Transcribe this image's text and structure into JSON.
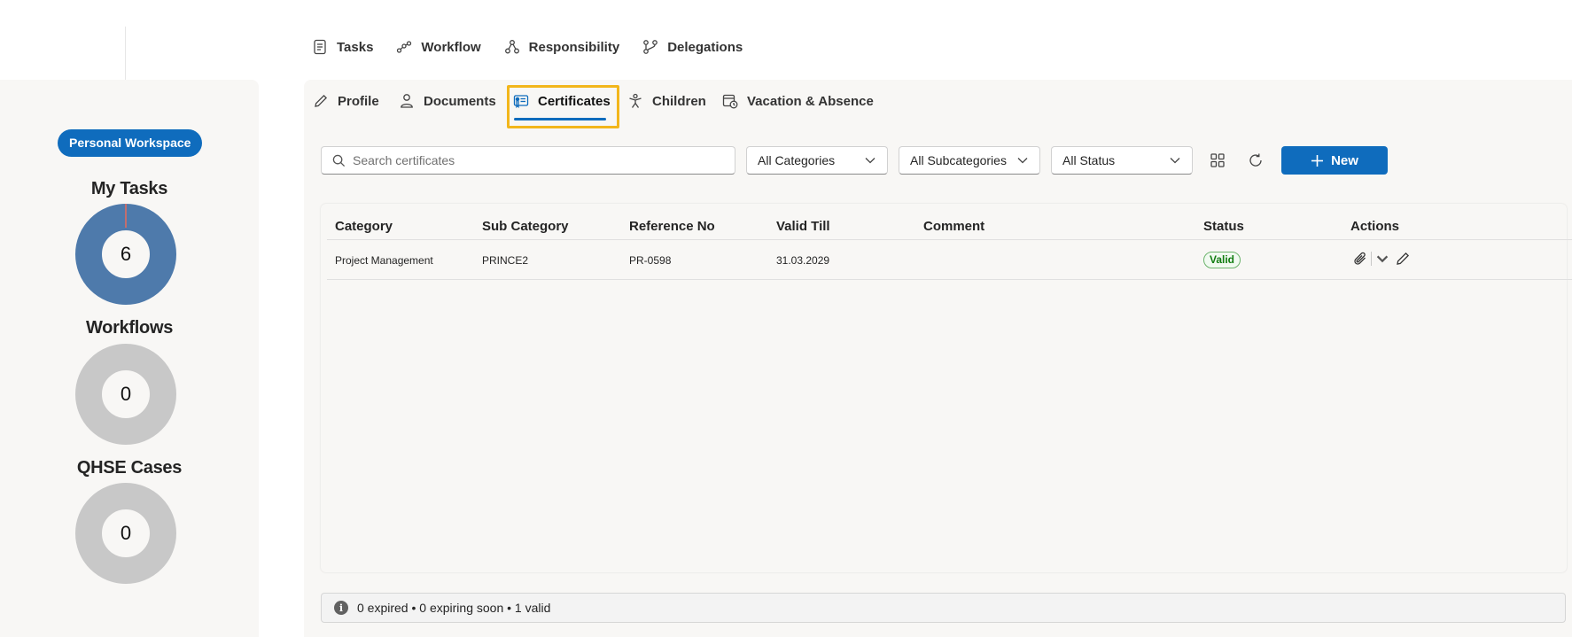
{
  "top_nav": [
    {
      "label": "Tasks",
      "icon": "tasks-icon"
    },
    {
      "label": "Workflow",
      "icon": "workflow-icon"
    },
    {
      "label": "Responsibility",
      "icon": "responsibility-icon"
    },
    {
      "label": "Delegations",
      "icon": "delegations-icon"
    }
  ],
  "sidebar": {
    "workspace_badge": "Personal Workspace",
    "kpis": [
      {
        "title": "My Tasks",
        "value": "6",
        "color": "#4e7aab"
      },
      {
        "title": "Workflows",
        "value": "0",
        "color": "#c8c8c8"
      },
      {
        "title": "QHSE Cases",
        "value": "0",
        "color": "#c8c8c8"
      }
    ]
  },
  "tabs": [
    {
      "label": "Profile",
      "icon": "pencil-icon"
    },
    {
      "label": "Documents",
      "icon": "person-icon"
    },
    {
      "label": "Certificates",
      "icon": "certificate-icon",
      "selected": true
    },
    {
      "label": "Children",
      "icon": "child-icon"
    },
    {
      "label": "Vacation & Absence",
      "icon": "calendar-clock-icon"
    }
  ],
  "filters": {
    "search_placeholder": "Search certificates",
    "category": "All Categories",
    "subcategory": "All Subcategories",
    "status": "All Status",
    "new_label": "New"
  },
  "table": {
    "columns": [
      "Category",
      "Sub Category",
      "Reference No",
      "Valid Till",
      "Comment",
      "Status",
      "Actions"
    ],
    "rows": [
      {
        "category": "Project Management",
        "sub_category": "PRINCE2",
        "reference_no": "PR-0598",
        "valid_till": "31.03.2029",
        "comment": "",
        "status": "Valid"
      }
    ]
  },
  "summary": "0 expired • 0 expiring soon • 1 valid",
  "colors": {
    "accent": "#0f6cbd",
    "selection_outline": "#f2b61b",
    "valid": "#107c10"
  }
}
